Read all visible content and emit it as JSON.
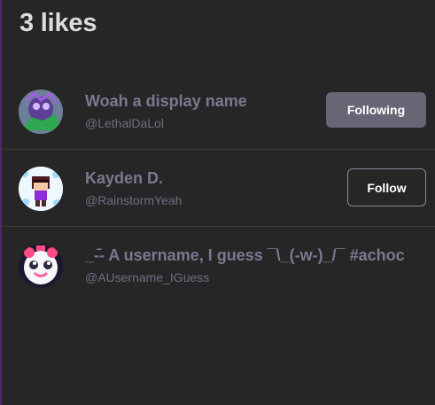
{
  "header": {
    "title": "3 likes"
  },
  "likes": [
    {
      "display_name": "Woah a display name",
      "handle": "@LethalDaLol",
      "button_label": "Following",
      "button_state": "following"
    },
    {
      "display_name": "Kayden D.",
      "handle": "@RainstormYeah",
      "button_label": "Follow",
      "button_state": "follow"
    },
    {
      "display_name": "_-̄- A username, I guess ¯\\_(-w-)_/¯ #achoc",
      "handle": "@AUsername_IGuess",
      "button_label": "",
      "button_state": "none"
    }
  ],
  "colors": {
    "background": "#262626",
    "title": "#dcdcdc",
    "name": "#7b7890",
    "handle": "#706d82",
    "following_button": "#696575",
    "follow_border": "#8a8898",
    "accent_bar": "#4a2a67"
  }
}
